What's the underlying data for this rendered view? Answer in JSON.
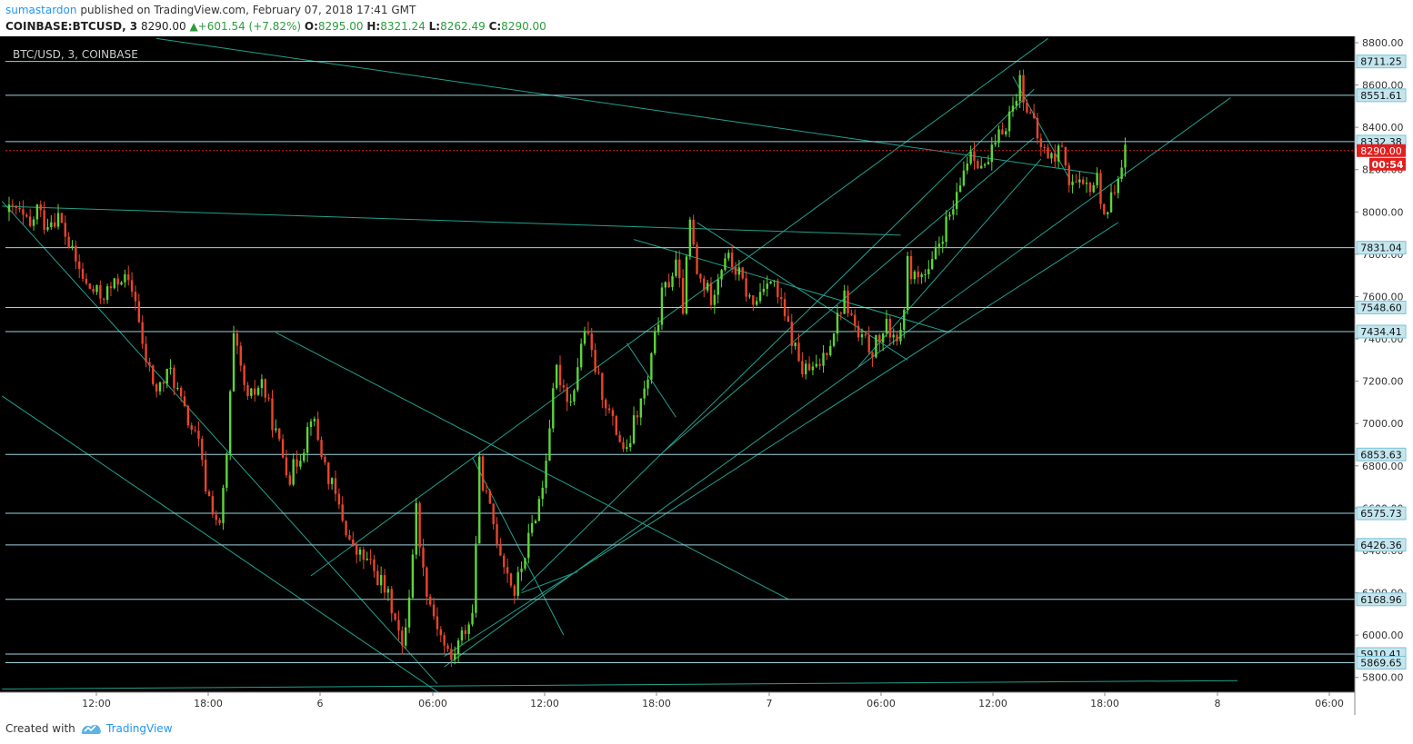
{
  "header": {
    "author": "sumastardon",
    "published_text": "published on TradingView.com, February 07, 2018 17:41 GMT",
    "symbol": "COINBASE:BTCUSD, 3",
    "last": "8290.00",
    "change": "▲+601.54 (+7.82%)",
    "o_label": "O:",
    "o": "8295.00",
    "h_label": "H:",
    "h": "8321.24",
    "l_label": "L:",
    "l": "8262.49",
    "c_label": "C:",
    "c": "8290.00"
  },
  "footer": {
    "created_with": "Created with",
    "brand": "TradingView"
  },
  "colors": {
    "background": "#000000",
    "up": "#5dd539",
    "down": "#e8452c",
    "line": "#21a18e",
    "level": "#9bd4e0",
    "current": "#e21f1f"
  },
  "chart_data": {
    "type": "candlestick",
    "title": "BTC/USD, 3, COINBASE",
    "ylim": [
      5730,
      8830
    ],
    "y_ticks": [
      5800,
      6000,
      6200,
      6400,
      6600,
      6800,
      7000,
      7200,
      7400,
      7600,
      7800,
      8000,
      8200,
      8400,
      8600,
      8800
    ],
    "x_ticks": [
      "12:00",
      "18:00",
      "6",
      "06:00",
      "12:00",
      "18:00",
      "7",
      "06:00",
      "12:00",
      "18:00",
      "8",
      "06:00"
    ],
    "horizontal_levels": [
      8711.25,
      8551.61,
      8332.38,
      7831.04,
      7548.6,
      7434.41,
      6853.63,
      6575.73,
      6426.36,
      6168.96,
      5910.41,
      5869.65
    ],
    "current_price": {
      "value": 8290.0,
      "label": "8290.00",
      "countdown": "00:54"
    },
    "price_path": [
      [
        0,
        8000
      ],
      [
        1,
        8010
      ],
      [
        3,
        7920
      ],
      [
        4,
        8020
      ],
      [
        5,
        7950
      ],
      [
        7,
        7980
      ],
      [
        9,
        7800
      ],
      [
        11,
        7650
      ],
      [
        13,
        7600
      ],
      [
        15,
        7650
      ],
      [
        16,
        7700
      ],
      [
        18,
        7600
      ],
      [
        19,
        7350
      ],
      [
        21,
        7150
      ],
      [
        23,
        7250
      ],
      [
        25,
        7050
      ],
      [
        27,
        6900
      ],
      [
        28,
        6700
      ],
      [
        30,
        6500
      ],
      [
        31,
        6850
      ],
      [
        32,
        7400
      ],
      [
        34,
        7100
      ],
      [
        36,
        7200
      ],
      [
        38,
        6950
      ],
      [
        40,
        6750
      ],
      [
        42,
        6900
      ],
      [
        43,
        7050
      ],
      [
        45,
        6800
      ],
      [
        47,
        6600
      ],
      [
        49,
        6400
      ],
      [
        51,
        6350
      ],
      [
        53,
        6250
      ],
      [
        55,
        6100
      ],
      [
        56,
        5920
      ],
      [
        57,
        6200
      ],
      [
        58,
        6600
      ],
      [
        59,
        6300
      ],
      [
        60,
        6150
      ],
      [
        62,
        5950
      ],
      [
        63,
        5880
      ],
      [
        64,
        5960
      ],
      [
        66,
        6100
      ],
      [
        67,
        6800
      ],
      [
        68,
        6650
      ],
      [
        70,
        6400
      ],
      [
        72,
        6200
      ],
      [
        74,
        6450
      ],
      [
        76,
        6700
      ],
      [
        77,
        7000
      ],
      [
        78,
        7250
      ],
      [
        80,
        7100
      ],
      [
        82,
        7450
      ],
      [
        84,
        7200
      ],
      [
        86,
        7000
      ],
      [
        88,
        6850
      ],
      [
        89,
        7000
      ],
      [
        91,
        7200
      ],
      [
        93,
        7600
      ],
      [
        95,
        7750
      ],
      [
        96,
        7550
      ],
      [
        97,
        7950
      ],
      [
        98,
        7700
      ],
      [
        100,
        7600
      ],
      [
        102,
        7800
      ],
      [
        104,
        7700
      ],
      [
        106,
        7550
      ],
      [
        108,
        7700
      ],
      [
        109,
        7650
      ],
      [
        111,
        7450
      ],
      [
        113,
        7250
      ],
      [
        115,
        7250
      ],
      [
        117,
        7400
      ],
      [
        119,
        7600
      ],
      [
        121,
        7400
      ],
      [
        123,
        7350
      ],
      [
        125,
        7450
      ],
      [
        127,
        7400
      ],
      [
        128,
        7750
      ],
      [
        129,
        7700
      ],
      [
        131,
        7700
      ],
      [
        133,
        7900
      ],
      [
        135,
        8050
      ],
      [
        136,
        8200
      ],
      [
        137,
        8300
      ],
      [
        139,
        8200
      ],
      [
        141,
        8350
      ],
      [
        143,
        8500
      ],
      [
        144,
        8620
      ],
      [
        145,
        8500
      ],
      [
        147,
        8300
      ],
      [
        149,
        8250
      ],
      [
        150,
        8330
      ],
      [
        151,
        8150
      ],
      [
        153,
        8100
      ],
      [
        155,
        8150
      ],
      [
        156,
        8000
      ],
      [
        157,
        8050
      ],
      [
        158,
        8200
      ],
      [
        159,
        8290
      ]
    ],
    "trend_lines": [
      [
        [
          -1,
          8050
        ],
        [
          61,
          5770
        ]
      ],
      [
        [
          -1,
          7130
        ],
        [
          62,
          5710
        ]
      ],
      [
        [
          -1,
          8027
        ],
        [
          127,
          7890
        ]
      ],
      [
        [
          -1,
          5745
        ],
        [
          175,
          5785
        ]
      ],
      [
        [
          21,
          8820
        ],
        [
          155,
          8180
        ]
      ],
      [
        [
          38,
          7430
        ],
        [
          111,
          6170
        ]
      ],
      [
        [
          62,
          5900
        ],
        [
          158,
          7950
        ]
      ],
      [
        [
          62,
          5850
        ],
        [
          174,
          8540
        ]
      ],
      [
        [
          43,
          6280
        ],
        [
          148,
          8820
        ]
      ],
      [
        [
          73,
          6210
        ],
        [
          146,
          8580
        ]
      ],
      [
        [
          66,
          6840
        ],
        [
          79,
          6000
        ]
      ],
      [
        [
          89,
          7870
        ],
        [
          134,
          7430
        ]
      ],
      [
        [
          98,
          7950
        ],
        [
          128,
          7300
        ]
      ],
      [
        [
          88,
          7380
        ],
        [
          95,
          7030
        ]
      ],
      [
        [
          93,
          6860
        ],
        [
          146,
          8350
        ]
      ],
      [
        [
          73,
          6200
        ],
        [
          81,
          6300
        ]
      ],
      [
        [
          143,
          8640
        ],
        [
          151,
          8160
        ]
      ],
      [
        [
          121,
          7270
        ],
        [
          147,
          8250
        ]
      ]
    ]
  }
}
